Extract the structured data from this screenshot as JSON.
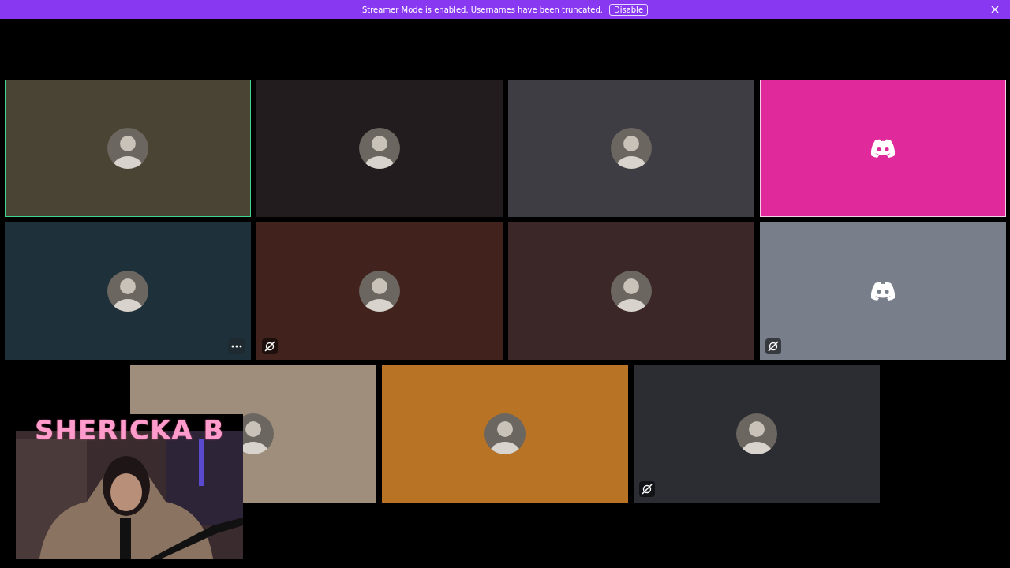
{
  "banner": {
    "message": "Streamer Mode is enabled. Usernames have been truncated.",
    "button": "Disable"
  },
  "tile_rows": [
    [
      {
        "color": "#4a4434",
        "kind": "picture",
        "speaking": true,
        "focused": false,
        "more_menu": false,
        "hidden_icon": false
      },
      {
        "color": "#221c1e",
        "kind": "picture",
        "speaking": false,
        "focused": false,
        "more_menu": false,
        "hidden_icon": false
      },
      {
        "color": "#3e3d44",
        "kind": "picture",
        "speaking": false,
        "focused": false,
        "more_menu": false,
        "hidden_icon": false
      },
      {
        "color": "#e02a9b",
        "kind": "default",
        "speaking": false,
        "focused": true,
        "more_menu": false,
        "hidden_icon": false
      }
    ],
    [
      {
        "color": "#1e313b",
        "kind": "picture",
        "speaking": false,
        "focused": false,
        "more_menu": true,
        "hidden_icon": false
      },
      {
        "color": "#42221c",
        "kind": "picture",
        "speaking": false,
        "focused": false,
        "more_menu": false,
        "hidden_icon": true
      },
      {
        "color": "#3b2628",
        "kind": "picture",
        "speaking": false,
        "focused": false,
        "more_menu": false,
        "hidden_icon": false
      },
      {
        "color": "#797e8b",
        "kind": "default",
        "speaking": false,
        "focused": false,
        "more_menu": false,
        "hidden_icon": true
      }
    ],
    [
      {
        "color": "#a08e7c",
        "kind": "picture",
        "speaking": false,
        "focused": false,
        "more_menu": false
      },
      {
        "color": "#b97325",
        "kind": "picture",
        "speaking": false,
        "focused": false,
        "more_menu": false,
        "hidden_icon": false
      },
      {
        "color": "#2c2d33",
        "kind": "picture",
        "speaking": false,
        "focused": false,
        "more_menu": false,
        "hidden_icon": true
      }
    ]
  ],
  "stream_overlay": {
    "name": "SHERICKA B",
    "webcam": {
      "kind": "picture"
    }
  }
}
